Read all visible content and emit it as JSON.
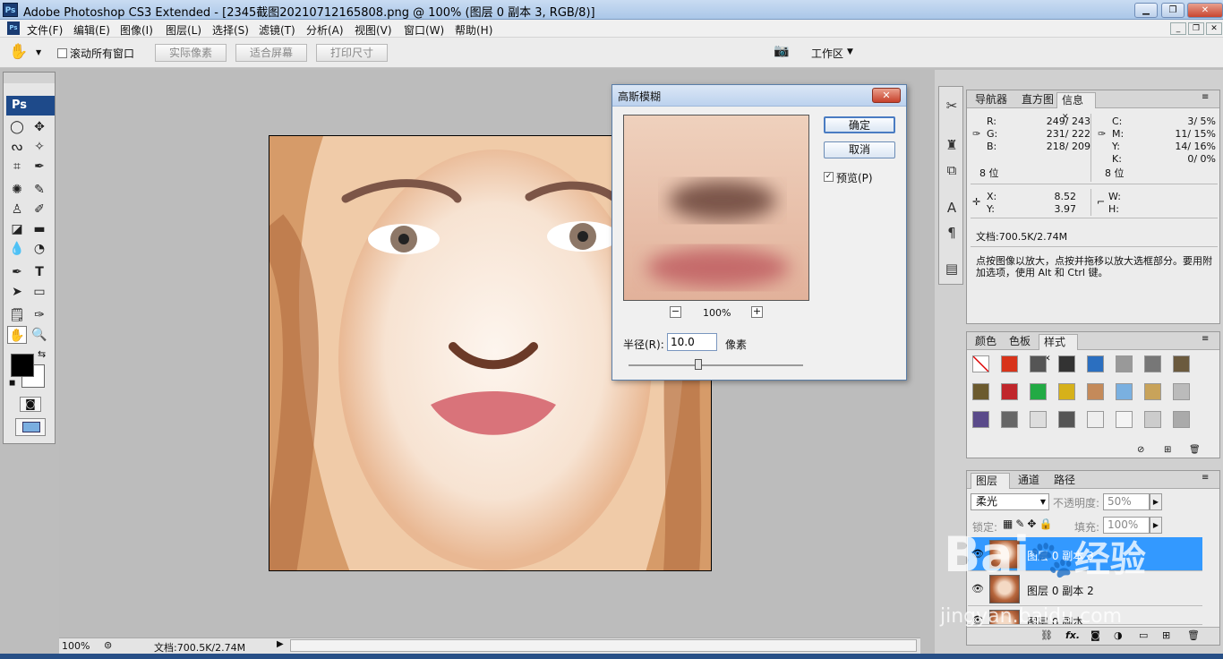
{
  "window": {
    "app_icon": "Ps",
    "title": "Adobe Photoshop CS3 Extended - [2345截图20210712165808.png @ 100% (图层 0 副本 3, RGB/8)]",
    "controls": [
      "minimize-icon",
      "maximize-icon",
      "close-icon"
    ]
  },
  "menubar": {
    "items": [
      "文件(F)",
      "编辑(E)",
      "图像(I)",
      "图层(L)",
      "选择(S)",
      "滤镜(T)",
      "分析(A)",
      "视图(V)",
      "窗口(W)",
      "帮助(H)"
    ]
  },
  "options": {
    "scroll_all": "滚动所有窗口",
    "actual_pixels": "实际像素",
    "fit_screen": "适合屏幕",
    "print_size": "打印尺寸",
    "workspace": "工作区"
  },
  "toolbox": {
    "logo": "Ps",
    "foreground": "#000000",
    "background": "#ffffff"
  },
  "status": {
    "zoom": "100%",
    "doc": "文档:700.5K/2.74M"
  },
  "dialog": {
    "title": "高斯模糊",
    "ok": "确定",
    "cancel": "取消",
    "preview_label": "预览(P)",
    "preview_checked": true,
    "zoom": "100%",
    "zoom_out": "−",
    "zoom_in": "+",
    "radius_label": "半径(R):",
    "radius_value": "10.0",
    "radius_unit": "像素",
    "radius_slider_fraction": 0.4
  },
  "info_panel": {
    "tabs": [
      "导航器",
      "直方图",
      "信息"
    ],
    "rgb": {
      "r_label": "R:",
      "r": "249/ 243",
      "g_label": "G:",
      "g": "231/ 222",
      "b_label": "B:",
      "b": "218/ 209"
    },
    "cmyk": {
      "c_label": "C:",
      "c": "3/  5%",
      "m_label": "M:",
      "m": "11/ 15%",
      "y_label": "Y:",
      "y": "14/ 16%",
      "k_label": "K:",
      "k": "0/  0%"
    },
    "bits_left": "8 位",
    "bits_right": "8 位",
    "x_label": "X:",
    "x": "8.52",
    "y_label": "Y:",
    "y": "3.97",
    "w_label": "W:",
    "h_label": "H:",
    "doc": "文档:700.5K/2.74M",
    "hint": "点按图像以放大，点按并拖移以放大选框部分。要用附加选项，使用 Alt 和 Ctrl 键。"
  },
  "styles_panel": {
    "tabs": [
      "颜色",
      "色板",
      "样式"
    ]
  },
  "layers_panel": {
    "tabs": [
      "图层",
      "通道",
      "路径"
    ],
    "blend_mode": "柔光",
    "opacity_label": "不透明度:",
    "opacity": "50%",
    "lock_label": "锁定:",
    "fill_label": "填充:",
    "fill": "100%",
    "layers": [
      {
        "name": "图层 0 副本 3",
        "selected": true
      },
      {
        "name": "图层 0 副本 2",
        "selected": false
      },
      {
        "name": "图层 0 副本",
        "selected": false
      }
    ]
  },
  "watermark": {
    "brand": "Bai",
    "brand_cn": "经验",
    "url": "jingyan.baidu.com"
  }
}
